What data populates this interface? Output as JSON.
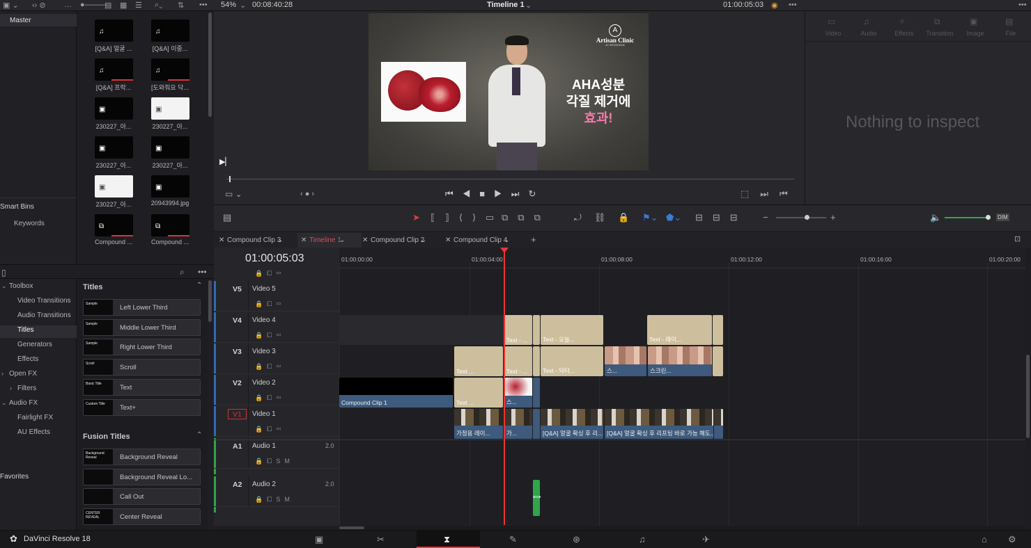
{
  "topbar": {
    "zoom": "54%",
    "duration": "00:08:40:28",
    "timeline_title": "Timeline 1",
    "timecode": "01:00:05:03"
  },
  "leftpanel": {
    "master": "Master",
    "smart_bins": "Smart Bins",
    "keywords": "Keywords",
    "favorites": "Favorites"
  },
  "mediapool": {
    "clips": [
      {
        "label": "[Q&A] 얼굴 ..."
      },
      {
        "label": "[Q&A] 이중..."
      },
      {
        "label": "[Q&A] 프락..."
      },
      {
        "label": "[도와줘요 닥..."
      },
      {
        "label": "230227_아..."
      },
      {
        "label": "230227_아..."
      },
      {
        "label": "230227_아..."
      },
      {
        "label": "230227_아..."
      },
      {
        "label": "230227_아..."
      },
      {
        "label": "20943994.jpg"
      },
      {
        "label": "Compound ..."
      },
      {
        "label": "Compound ..."
      }
    ]
  },
  "viewer": {
    "brand": "Artisan Clinic",
    "brand_sub": "at CHEONGDAM",
    "headline1": "AHA성분",
    "headline2": "각질 제거에",
    "headline3": "효과!"
  },
  "inspector": {
    "tabs": [
      "Video",
      "Audio",
      "Effects",
      "Transition",
      "Image",
      "File"
    ],
    "empty_text": "Nothing to inspect"
  },
  "fxlib": {
    "tree": [
      "Toolbox",
      "Video Transitions",
      "Audio Transitions",
      "Titles",
      "Generators",
      "Effects",
      "Open FX",
      "Filters",
      "Audio FX",
      "Fairlight FX",
      "AU Effects"
    ],
    "titles_header": "Titles",
    "titles": [
      {
        "name": "Left Lower Third",
        "thumb": "Sample"
      },
      {
        "name": "Middle Lower Third",
        "thumb": "Sample"
      },
      {
        "name": "Right Lower Third",
        "thumb": "Sample"
      },
      {
        "name": "Scroll",
        "thumb": "Scroll"
      },
      {
        "name": "Text",
        "thumb": "Basic Title"
      },
      {
        "name": "Text+",
        "thumb": "Custom Title"
      }
    ],
    "fusion_header": "Fusion Titles",
    "fusion": [
      {
        "name": "Background Reveal",
        "thumb": "Background Reveal"
      },
      {
        "name": "Background Reveal Lo...",
        "thumb": ""
      },
      {
        "name": "Call Out",
        "thumb": ""
      },
      {
        "name": "Center Reveal",
        "thumb": "CENTER REVEAL"
      }
    ]
  },
  "tabs": [
    "Compound Clip 3",
    "Timeline 1",
    "Compound Clip 2",
    "Compound Clip 4"
  ],
  "timeline": {
    "current_tc": "01:00:05:03",
    "ruler": [
      "01:00:00:00",
      "01:00:04:00",
      "01:00:08:00",
      "01:00:12:00",
      "01:00:16:00",
      "01:00:20:00"
    ],
    "tracks": [
      {
        "id": "V5",
        "name": "Video 5"
      },
      {
        "id": "V4",
        "name": "Video 4"
      },
      {
        "id": "V3",
        "name": "Video 3"
      },
      {
        "id": "V2",
        "name": "Video 2"
      },
      {
        "id": "V1",
        "name": "Video 1"
      },
      {
        "id": "A1",
        "name": "Audio 1",
        "ch": "2.0"
      },
      {
        "id": "A2",
        "name": "Audio 2",
        "ch": "2.0"
      }
    ],
    "clips": {
      "v4a": "Text - ...",
      "v4b": "Text - 오늘...",
      "v4c": "Text - 레이...",
      "v3a": "Text ...",
      "v3b": "Text - ...",
      "v3c": "Text - 닥터...",
      "v3d": "스...",
      "v3e": "스크린...",
      "v2a": "Compound Clip 1",
      "v2b": "Text ...",
      "v2c": "스...",
      "v1a": "가정용 레이...",
      "v1b": "가...",
      "v1c": "[Q&A] 얼굴 확싱 후 리...",
      "v1d": "[Q&A] 얼굴 확싱 후 리프팅 바로 가능 해도..."
    }
  },
  "status": {
    "app": "DaVinci Resolve 18"
  },
  "colors": {
    "accent_red": "#e33",
    "clip_tan": "#cdbf9e",
    "clip_blue": "#3e5a7c",
    "audio_green": "#2fa64a"
  }
}
